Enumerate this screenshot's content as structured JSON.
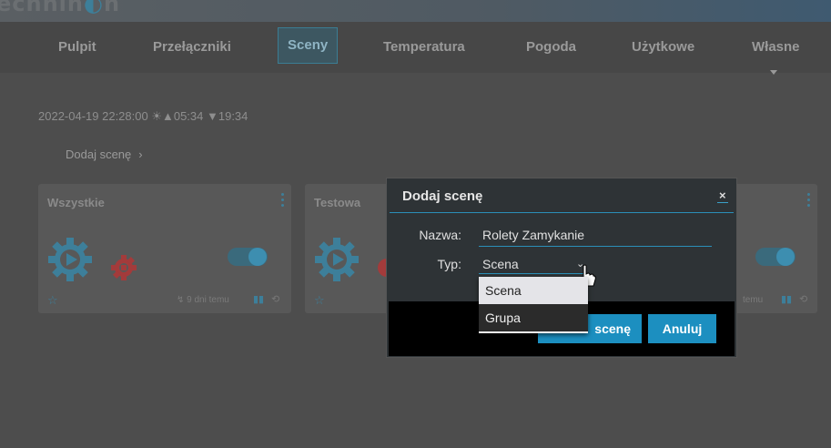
{
  "app": {
    "logo_text": "ecnnin",
    "logo_suffix": "n"
  },
  "nav": {
    "items": [
      {
        "label": "Pulpit"
      },
      {
        "label": "Przełączniki"
      },
      {
        "label": "Sceny"
      },
      {
        "label": "Temperatura"
      },
      {
        "label": "Pogoda"
      },
      {
        "label": "Użytkowe"
      },
      {
        "label": "Własne"
      }
    ],
    "active": "Sceny"
  },
  "status": {
    "line": "2022-04-19 22:28:00 ☀▲05:34 ▼19:34"
  },
  "add_scene_link": {
    "label": "Dodaj scenę",
    "chevron": "›"
  },
  "cards": [
    {
      "title": "Wszystkie",
      "last_used": "↯ 9 dni temu"
    },
    {
      "title": "Testowa"
    },
    {
      "title": ""
    }
  ],
  "card_partial_text": "temu",
  "modal": {
    "title": "Dodaj scenę",
    "close": "×",
    "name_label": "Nazwa:",
    "name_value": "Rolety Zamykanie",
    "type_label": "Typ:",
    "type_value": "Scena",
    "type_options": [
      "Scena",
      "Grupa"
    ],
    "add_button": "Dodaj scenę",
    "add_button_visible": "scenę",
    "cancel_button": "Anuluj"
  },
  "colors": {
    "accent": "#1c8fc0",
    "background": "#4d4d4d",
    "modal": "#2e3336"
  }
}
